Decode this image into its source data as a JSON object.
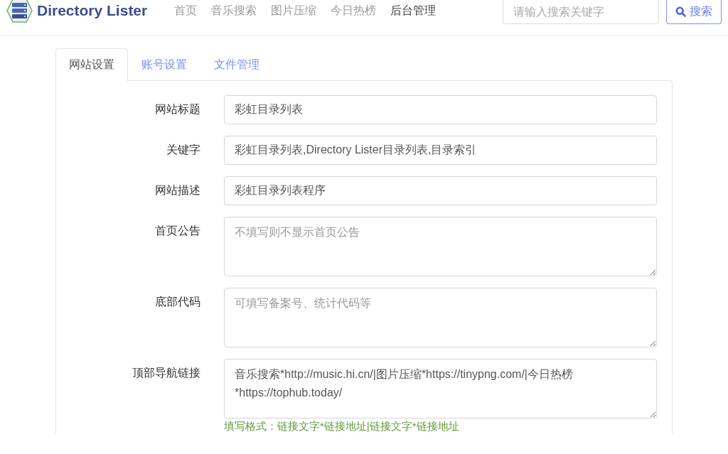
{
  "navbar": {
    "brand": "Directory Lister",
    "links": [
      {
        "label": "首页",
        "selected": false
      },
      {
        "label": "音乐搜索",
        "selected": false
      },
      {
        "label": "图片压缩",
        "selected": false
      },
      {
        "label": "今日热榜",
        "selected": false
      },
      {
        "label": "后台管理",
        "selected": true
      }
    ],
    "search": {
      "placeholder": "请输入搜索关键字",
      "button": "搜索"
    }
  },
  "tabs": [
    {
      "label": "网站设置",
      "selected": true
    },
    {
      "label": "账号设置",
      "selected": false
    },
    {
      "label": "文件管理",
      "selected": false
    }
  ],
  "fields": [
    {
      "label": "网站标题",
      "kind": "input",
      "value": "彩虹目录列表"
    },
    {
      "label": "关键字",
      "kind": "input",
      "value": "彩虹目录列表,Directory Lister目录列表,目录索引"
    },
    {
      "label": "网站描述",
      "kind": "input",
      "value": "彩虹目录列表程序"
    },
    {
      "label": "首页公告",
      "kind": "textarea",
      "placeholder": "不填写则不显示首页公告"
    },
    {
      "label": "底部代码",
      "kind": "textarea",
      "placeholder": "可填写备案号、统计代码等"
    },
    {
      "label": "顶部导航链接",
      "kind": "textarea",
      "value": "音乐搜索*http://music.hi.cn/|图片压缩*https://tinypng.com/|今日热榜*https://tophub.today/",
      "help": "填写格式：链接文字*链接地址|链接文字*链接地址"
    }
  ]
}
